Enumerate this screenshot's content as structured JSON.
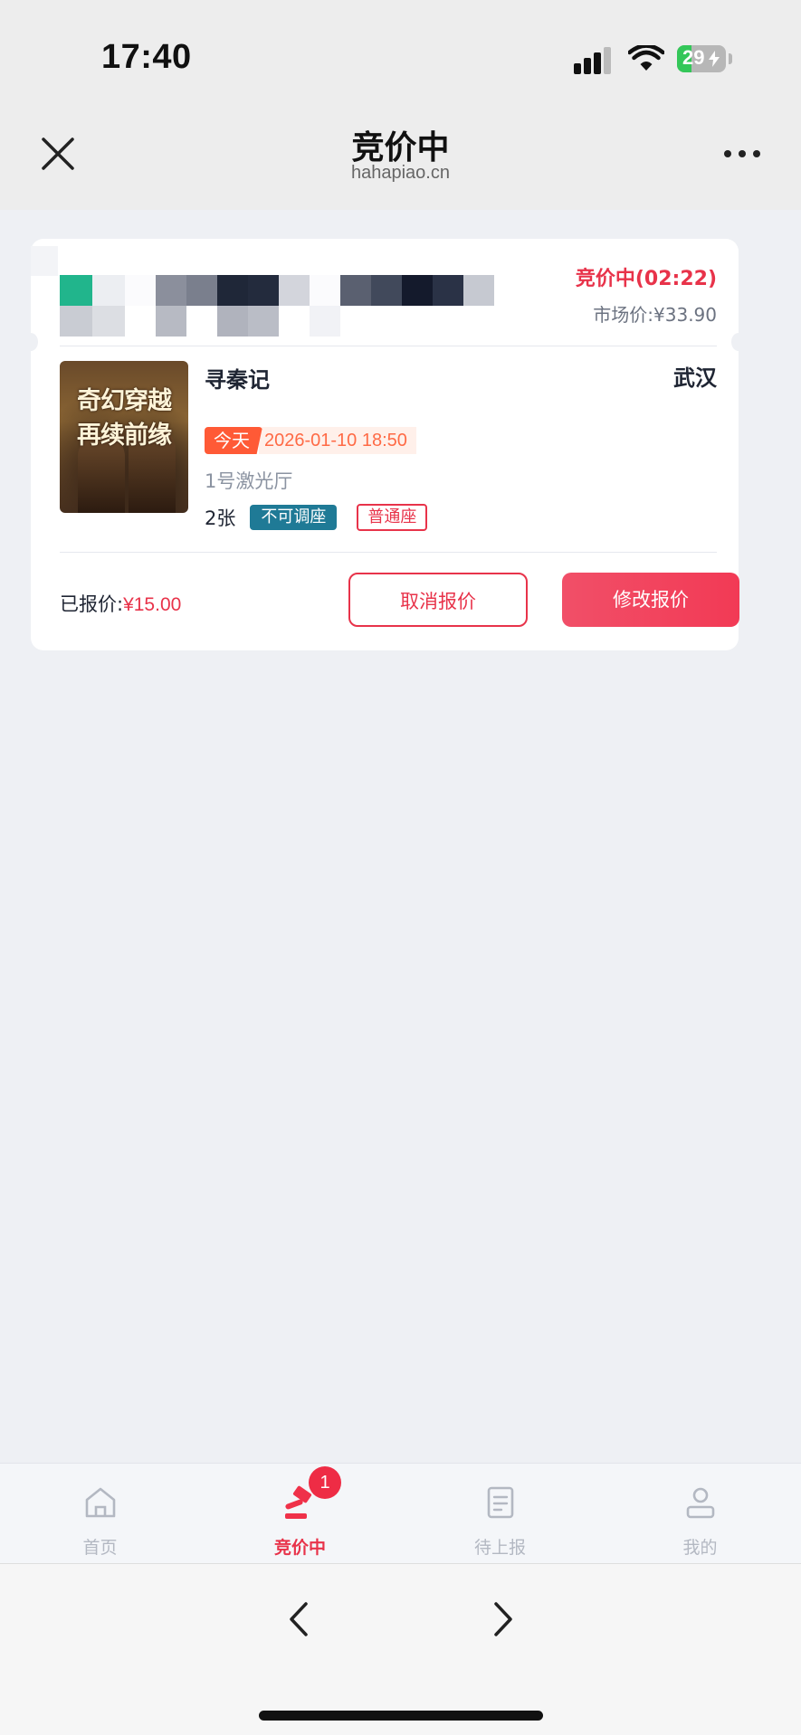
{
  "status_bar": {
    "time": "17:40",
    "battery": "29",
    "battery_level_percent": 29
  },
  "nav": {
    "title": "竞价中",
    "subtitle": "hahapiao.cn"
  },
  "order": {
    "auction_status": "竞价中(02:22)",
    "market_price": "市场价:¥33.90",
    "movie_title": "寻秦记",
    "city": "武汉",
    "poster_lines": [
      "奇幻穿越",
      "再续前缘"
    ],
    "today_label": "今天",
    "showtime": "2026-01-10 18:50",
    "hall": "1号激光厅",
    "ticket_count": "2张",
    "tag_seat_lock": "不可调座",
    "tag_seat_type": "普通座",
    "bid_label": "已报价:",
    "bid_amount": "¥15.00",
    "cancel_label": "取消报价",
    "modify_label": "修改报价"
  },
  "tabbar": {
    "items": [
      {
        "label": "首页",
        "icon": "home-icon",
        "active": false
      },
      {
        "label": "竞价中",
        "icon": "gavel-icon",
        "active": true,
        "badge": "1"
      },
      {
        "label": "待上报",
        "icon": "document-icon",
        "active": false
      },
      {
        "label": "我的",
        "icon": "user-icon",
        "active": false
      }
    ]
  },
  "colors": {
    "accent": "#e8334a",
    "tag_blue": "#1f7a96",
    "today_orange": "#ff5a36",
    "page_bg": "#eef0f4"
  }
}
